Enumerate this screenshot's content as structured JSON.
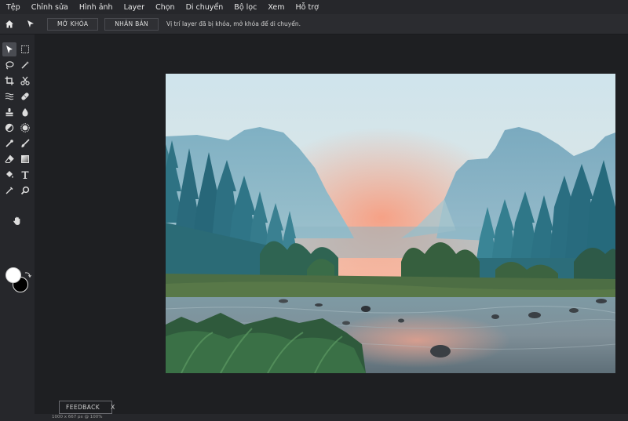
{
  "menu": [
    "Tệp",
    "Chỉnh sửa",
    "Hình ảnh",
    "Layer",
    "Chọn",
    "Di chuyển",
    "Bộ lọc",
    "Xem",
    "Hỗ trợ"
  ],
  "options": {
    "unlock_label": "MỞ KHÓA",
    "duplicate_label": "NHÂN BẢN",
    "message": "Vị trí layer đã bị khóa, mở khóa để di chuyển."
  },
  "tools": [
    "move-tool-icon",
    "marquee-tool-icon",
    "lasso-tool-icon",
    "magic-wand-icon",
    "crop-tool-icon",
    "scissors-icon",
    "liquify-icon",
    "healing-brush-icon",
    "clone-stamp-icon",
    "blur-drop-icon",
    "dodge-burn-icon",
    "sponge-icon",
    "eyedropper-icon",
    "brush-icon",
    "eraser-icon",
    "gradient-icon",
    "paint-bucket-icon",
    "text-tool-icon",
    "pen-tool-icon",
    "zoom-icon",
    "hand-tool-icon"
  ],
  "colors": {
    "foreground": "#ffffff",
    "background": "#000000",
    "ui_dark": "#1e1f22",
    "ui_panel": "#26272b"
  },
  "feedback": {
    "label": "FEEDBACK",
    "close": "X"
  },
  "status": "1000 x 667 px @ 100%"
}
